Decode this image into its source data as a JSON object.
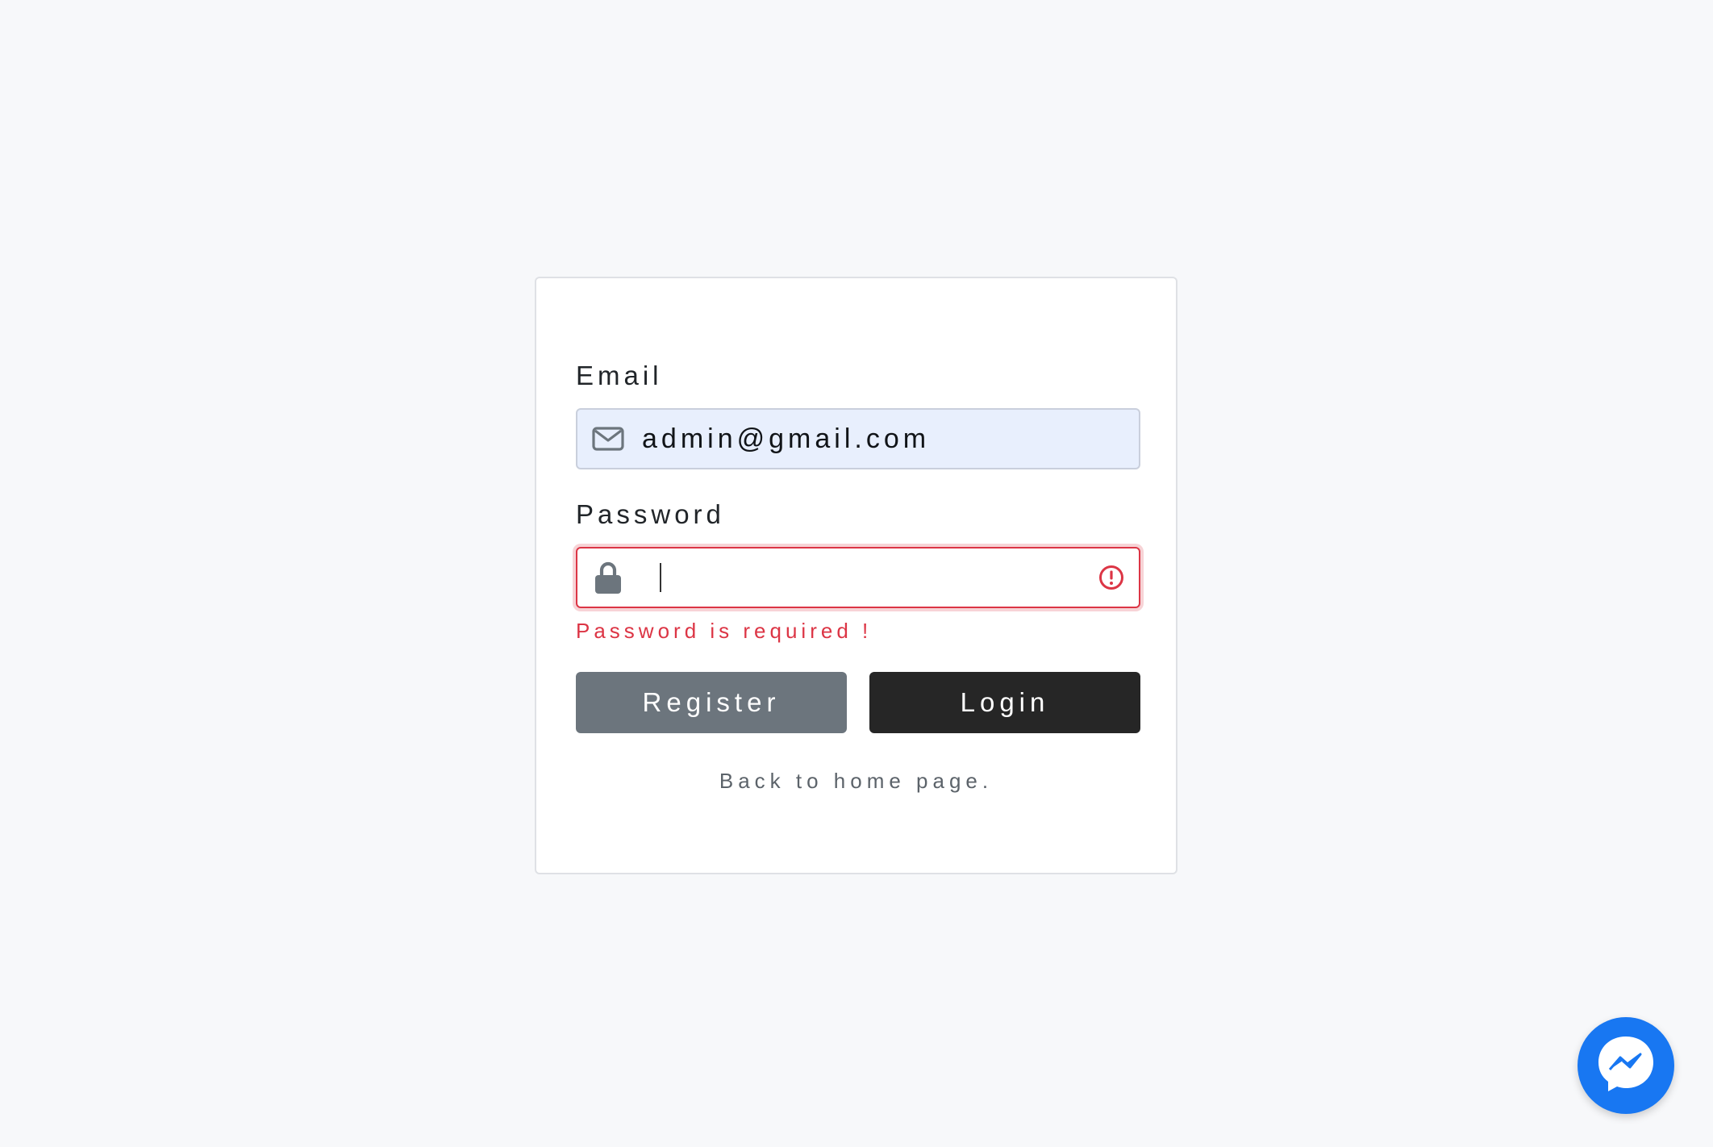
{
  "login_form": {
    "email_label": "Email",
    "email_value": "admin@gmail.com",
    "password_label": "Password",
    "password_value": "",
    "password_error": "Password is required !",
    "register_label": "Register",
    "login_label": "Login",
    "back_link": "Back to home page."
  },
  "icons": {
    "email": "envelope-icon",
    "password": "lock-icon",
    "error": "exclamation-circle-icon",
    "chat": "messenger-icon"
  },
  "colors": {
    "background": "#f7f8fa",
    "email_field_bg": "#e8effd",
    "error": "#dc3545",
    "register_button": "#6c757d",
    "login_button": "#262626",
    "messenger": "#1877f2"
  }
}
